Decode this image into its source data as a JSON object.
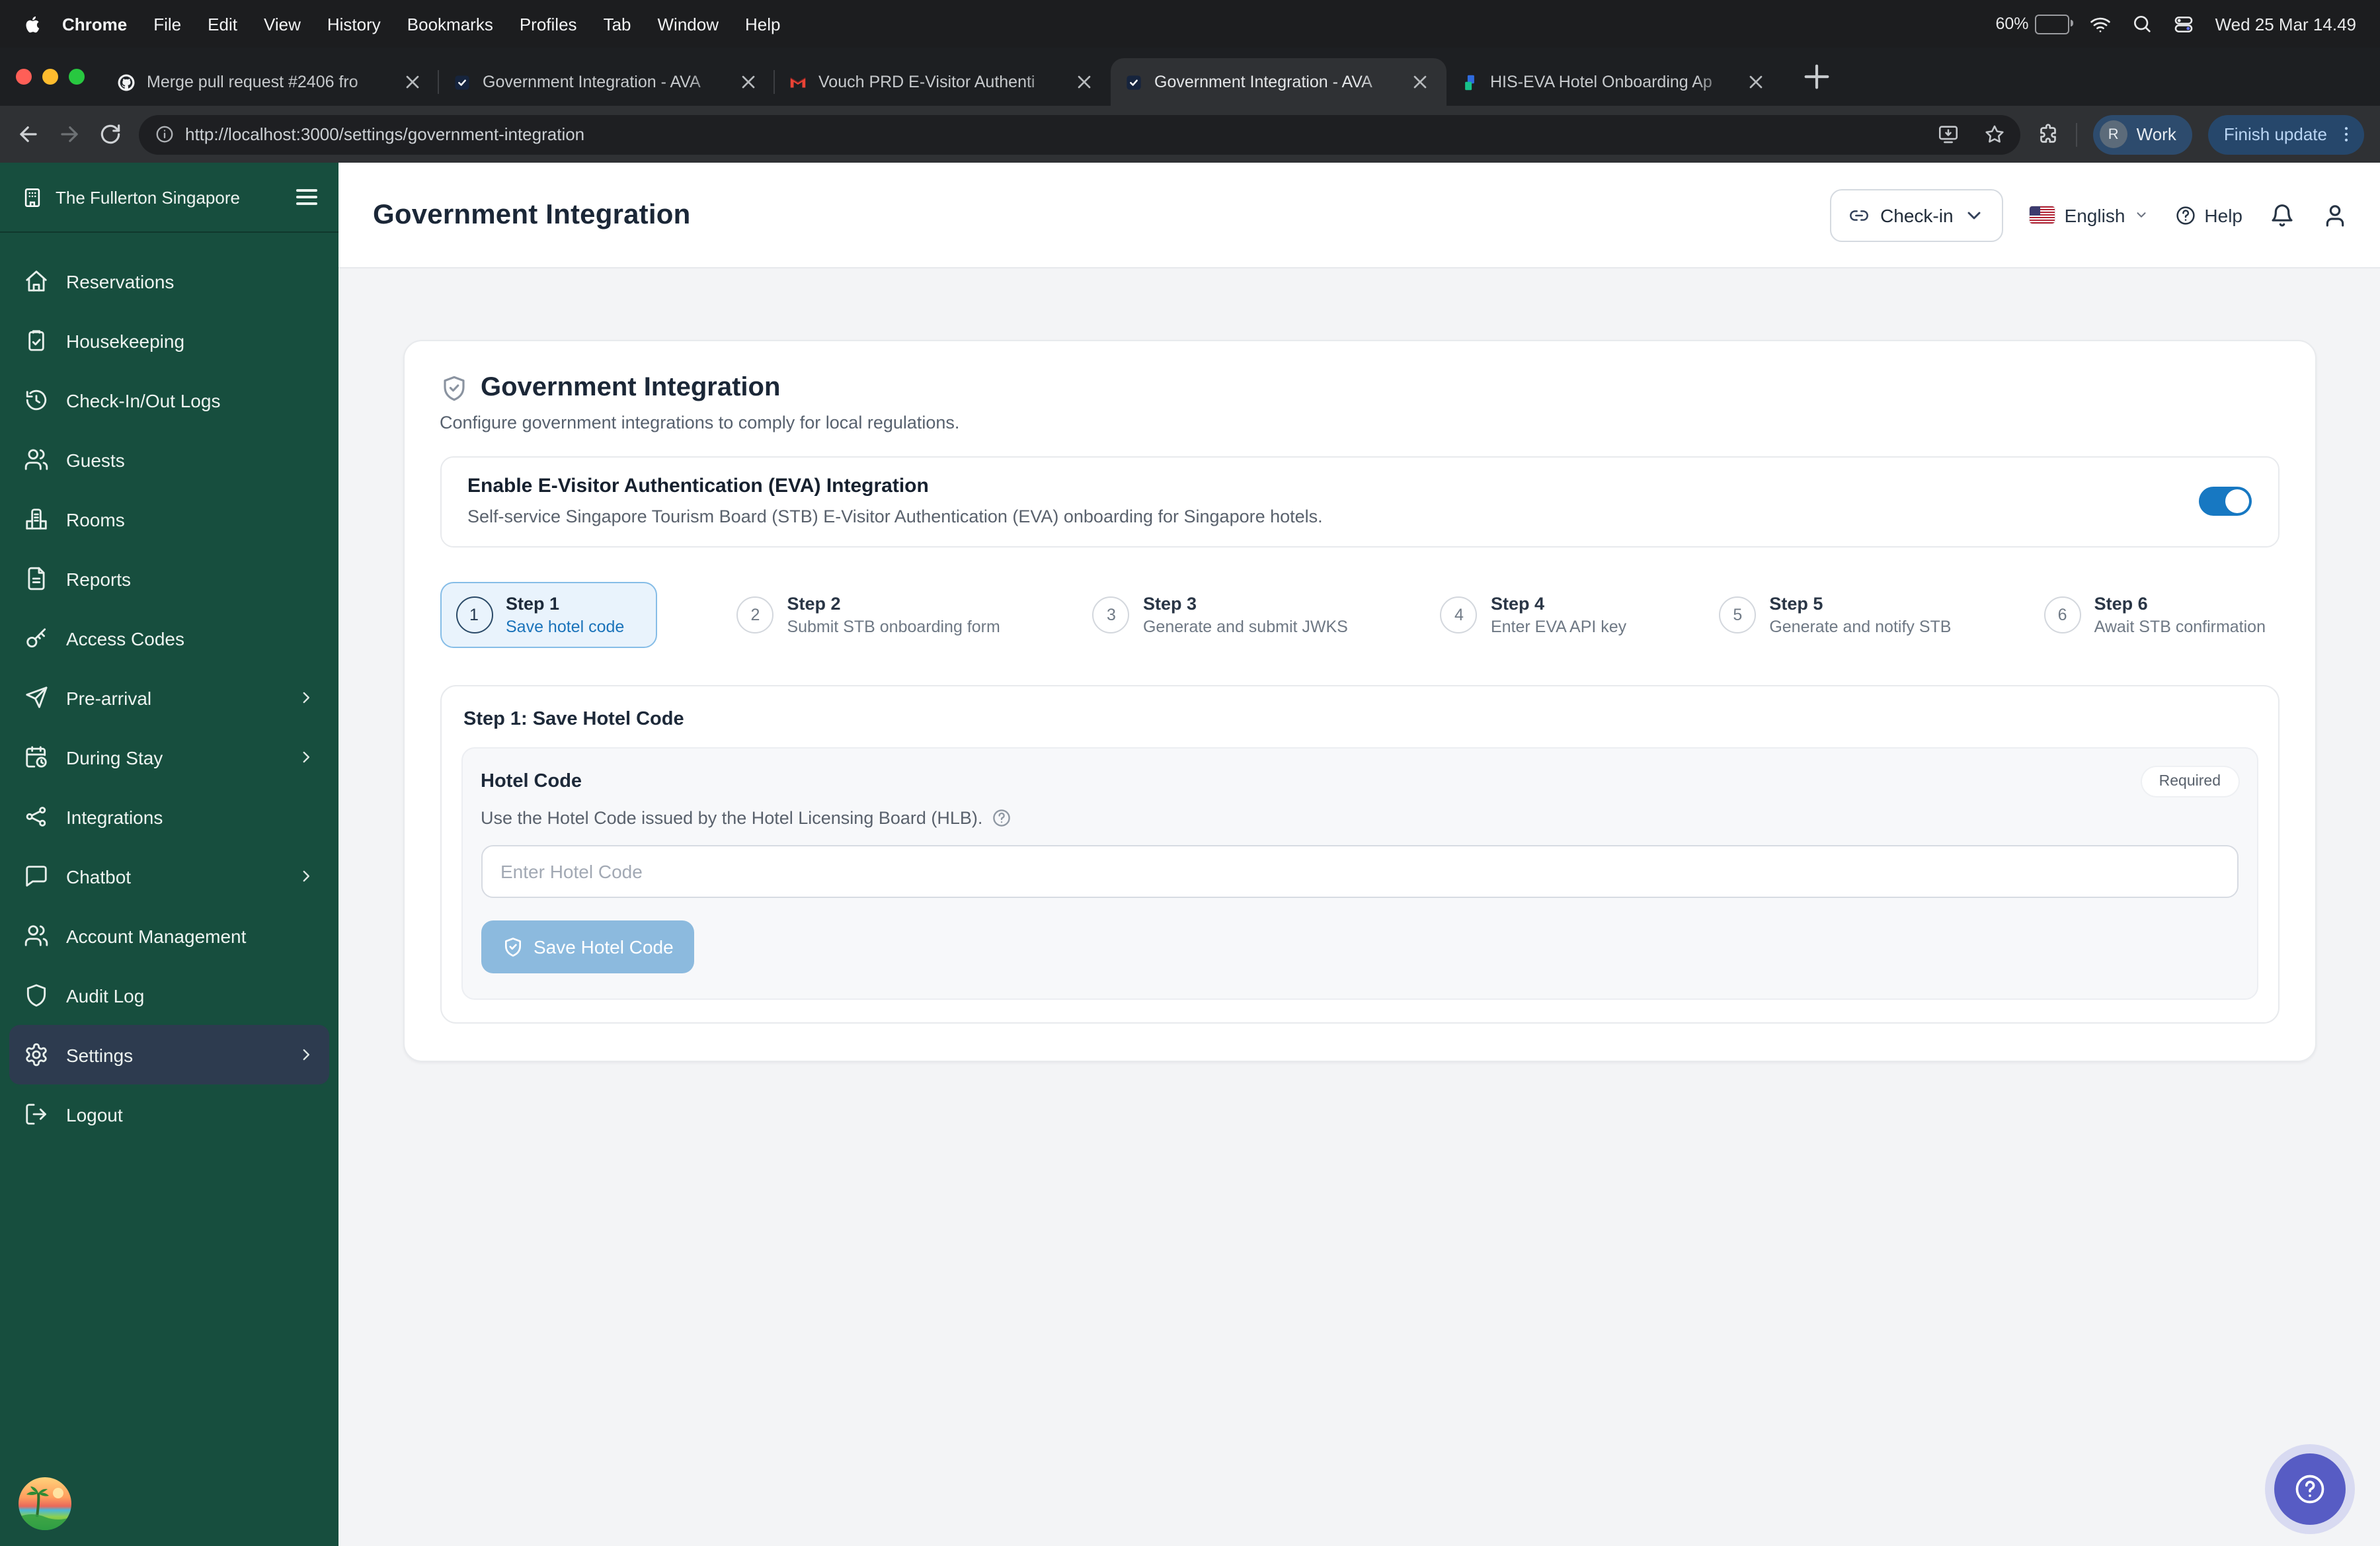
{
  "colors": {
    "accent_blue": "#1778c2",
    "sidebar_green": "#174e3e",
    "active_item_navy": "#2d3b4f",
    "fab_purple": "#575cc4",
    "battery_yellow": "#f7ce46",
    "step_active_bg": "#e9f3fc"
  },
  "menubar": {
    "items": [
      {
        "label": "Chrome",
        "strong": true
      },
      {
        "label": "File"
      },
      {
        "label": "Edit"
      },
      {
        "label": "View"
      },
      {
        "label": "History"
      },
      {
        "label": "Bookmarks"
      },
      {
        "label": "Profiles"
      },
      {
        "label": "Tab"
      },
      {
        "label": "Window"
      },
      {
        "label": "Help"
      }
    ],
    "status_icons": [
      {
        "name": "record-icon"
      },
      {
        "name": "cast-icon"
      },
      {
        "name": "keyboard-alert-icon"
      },
      {
        "name": "arch-icon"
      },
      {
        "name": "play-circle-icon"
      },
      {
        "name": "stage-light-icon"
      }
    ],
    "battery": "60%",
    "datetime": "Wed 25 Mar 14.49"
  },
  "tabs": [
    {
      "favicon": "github-icon",
      "title": "Merge pull request #2406 fro"
    },
    {
      "favicon": "vouch-icon",
      "title": "Government Integration - AVA"
    },
    {
      "favicon": "gmail-icon",
      "title": "Vouch PRD E-Visitor Authenti"
    },
    {
      "favicon": "vouch-icon",
      "title": "Government Integration - AVA",
      "active": true
    },
    {
      "favicon": "hiseva-icon",
      "title": "HIS-EVA Hotel Onboarding Ap"
    }
  ],
  "toolbar": {
    "url": "http://localhost:3000/settings/government-integration",
    "profile_initial": "R",
    "profile_label": "Work",
    "update_label": "Finish update"
  },
  "sidebar": {
    "hotel_name": "The Fullerton Singapore",
    "items": [
      {
        "icon": "home-icon",
        "label": "Reservations"
      },
      {
        "icon": "clipboard-check-icon",
        "label": "Housekeeping"
      },
      {
        "icon": "history-icon",
        "label": "Check-In/Out Logs"
      },
      {
        "icon": "users-icon",
        "label": "Guests"
      },
      {
        "icon": "hotel-icon",
        "label": "Rooms"
      },
      {
        "icon": "file-text-icon",
        "label": "Reports"
      },
      {
        "icon": "key-icon",
        "label": "Access Codes"
      },
      {
        "icon": "send-icon",
        "label": "Pre-arrival",
        "chevron": true
      },
      {
        "icon": "calendar-clock-icon",
        "label": "During Stay",
        "chevron": true
      },
      {
        "icon": "share-nodes-icon",
        "label": "Integrations"
      },
      {
        "icon": "message-icon",
        "label": "Chatbot",
        "chevron": true
      },
      {
        "icon": "users-icon",
        "label": "Account Management"
      },
      {
        "icon": "shield-icon",
        "label": "Audit Log"
      },
      {
        "icon": "gear-icon",
        "label": "Settings",
        "chevron": true,
        "active": true
      },
      {
        "icon": "logout-icon",
        "label": "Logout"
      }
    ]
  },
  "header": {
    "title": "Government Integration",
    "checkin_label": "Check-in",
    "language": "English",
    "help_label": "Help"
  },
  "main": {
    "card": {
      "title": "Government Integration",
      "subtitle": "Configure government integrations to comply for local regulations.",
      "eva_title": "Enable E-Visitor Authentication (EVA) Integration",
      "eva_desc": "Self-service Singapore Tourism Board (STB) E-Visitor Authentication (EVA) onboarding for Singapore hotels.",
      "eva_enabled": true
    },
    "steps": [
      {
        "num": "1",
        "title": "Step 1",
        "sub": "Save hotel code",
        "active": true
      },
      {
        "num": "2",
        "title": "Step 2",
        "sub": "Submit STB onboarding form"
      },
      {
        "num": "3",
        "title": "Step 3",
        "sub": "Generate and submit JWKS"
      },
      {
        "num": "4",
        "title": "Step 4",
        "sub": "Enter EVA API key"
      },
      {
        "num": "5",
        "title": "Step 5",
        "sub": "Generate and notify STB"
      },
      {
        "num": "6",
        "title": "Step 6",
        "sub": "Await STB confirmation"
      }
    ],
    "step1": {
      "heading": "Step 1: Save Hotel Code",
      "field_label": "Hotel Code",
      "required_badge": "Required",
      "field_desc": "Use the Hotel Code issued by the Hotel Licensing Board (HLB).",
      "input_value": "",
      "input_placeholder": "Enter Hotel Code",
      "save_label": "Save Hotel Code"
    }
  }
}
